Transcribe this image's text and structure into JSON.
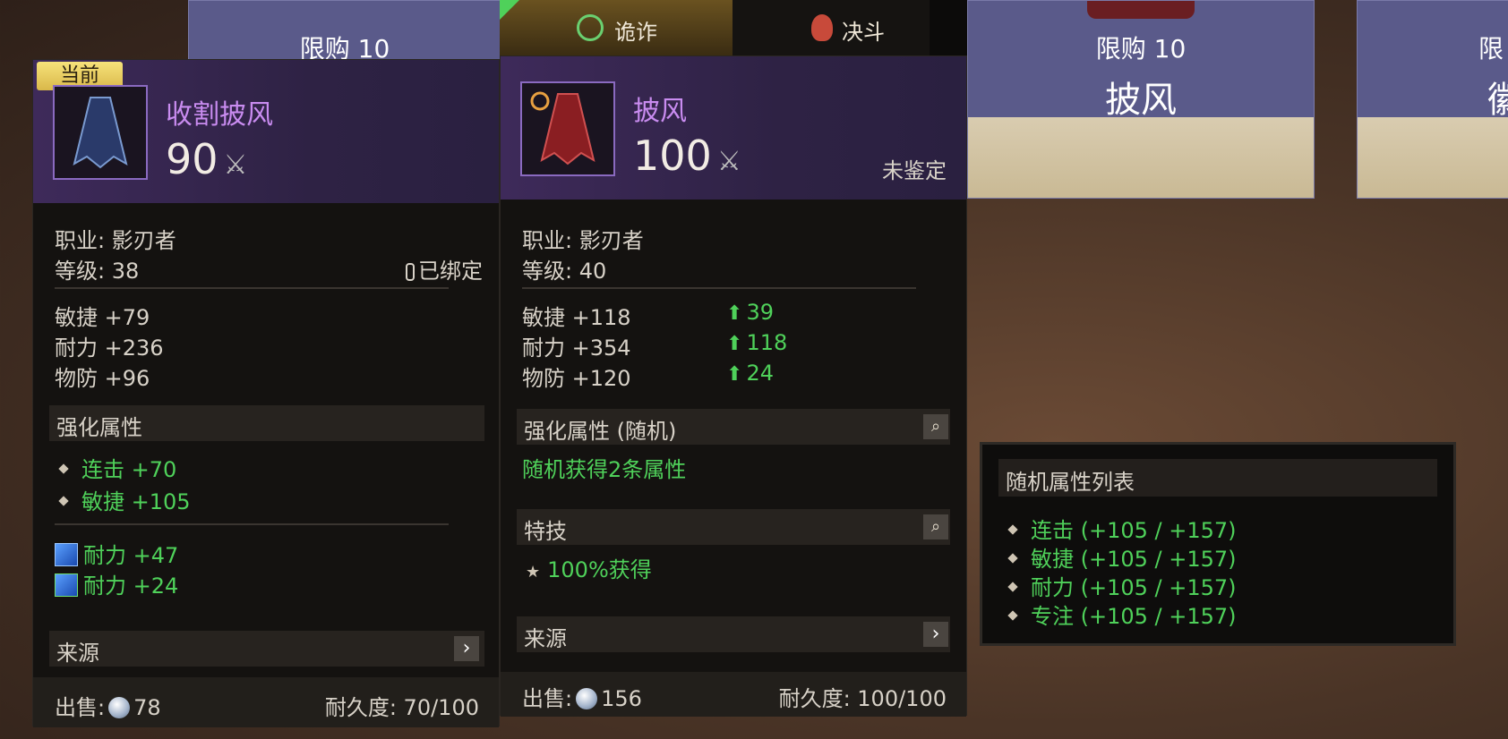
{
  "shop_cards": [
    {
      "limit": "限购 10",
      "name": ""
    },
    {
      "limit": "限购 10",
      "name": "披风"
    },
    {
      "limit": "限",
      "name": "徽"
    }
  ],
  "tabs": [
    {
      "label": "诡诈",
      "icon": "eye-icon"
    },
    {
      "label": "决斗",
      "icon": "flame-emblem-icon"
    }
  ],
  "current_item": {
    "badge": "当前",
    "name": "收割披风",
    "score": "90",
    "class_line": "职业: 影刃者",
    "level_line": "等级: 38",
    "bound": "已绑定",
    "stats": [
      "敏捷 +79",
      "耐力 +236",
      "物防 +96"
    ],
    "enhance_title": "强化属性",
    "enhance": [
      "连击 +70",
      "敏捷 +105"
    ],
    "gems": [
      "耐力 +47",
      "耐力 +24"
    ],
    "source_label": "来源",
    "sell_label": "出售:",
    "sell_value": "78",
    "durability": "耐久度: 70/100"
  },
  "compare_item": {
    "name": "披风",
    "score": "100",
    "unidentified": "未鉴定",
    "class_line": "职业: 影刃者",
    "level_line": "等级: 40",
    "stats": [
      {
        "text": "敏捷 +118",
        "diff": "39"
      },
      {
        "text": "耐力 +354",
        "diff": "118"
      },
      {
        "text": "物防 +120",
        "diff": "24"
      }
    ],
    "enhance_title": "强化属性 (随机)",
    "enhance_text": "随机获得2条属性",
    "skill_title": "特技",
    "skill_text": "100%获得",
    "source_label": "来源",
    "sell_label": "出售:",
    "sell_value": "156",
    "durability": "耐久度: 100/100"
  },
  "random_list": {
    "title": "随机属性列表",
    "items": [
      "连击 (+105 / +157)",
      "敏捷 (+105 / +157)",
      "耐力 (+105 / +157)",
      "专注 (+105 / +157)"
    ]
  },
  "colors": {
    "accent_purple": "#c98cf0",
    "positive_green": "#4fd15a",
    "badge_gold": "#f0d060"
  }
}
